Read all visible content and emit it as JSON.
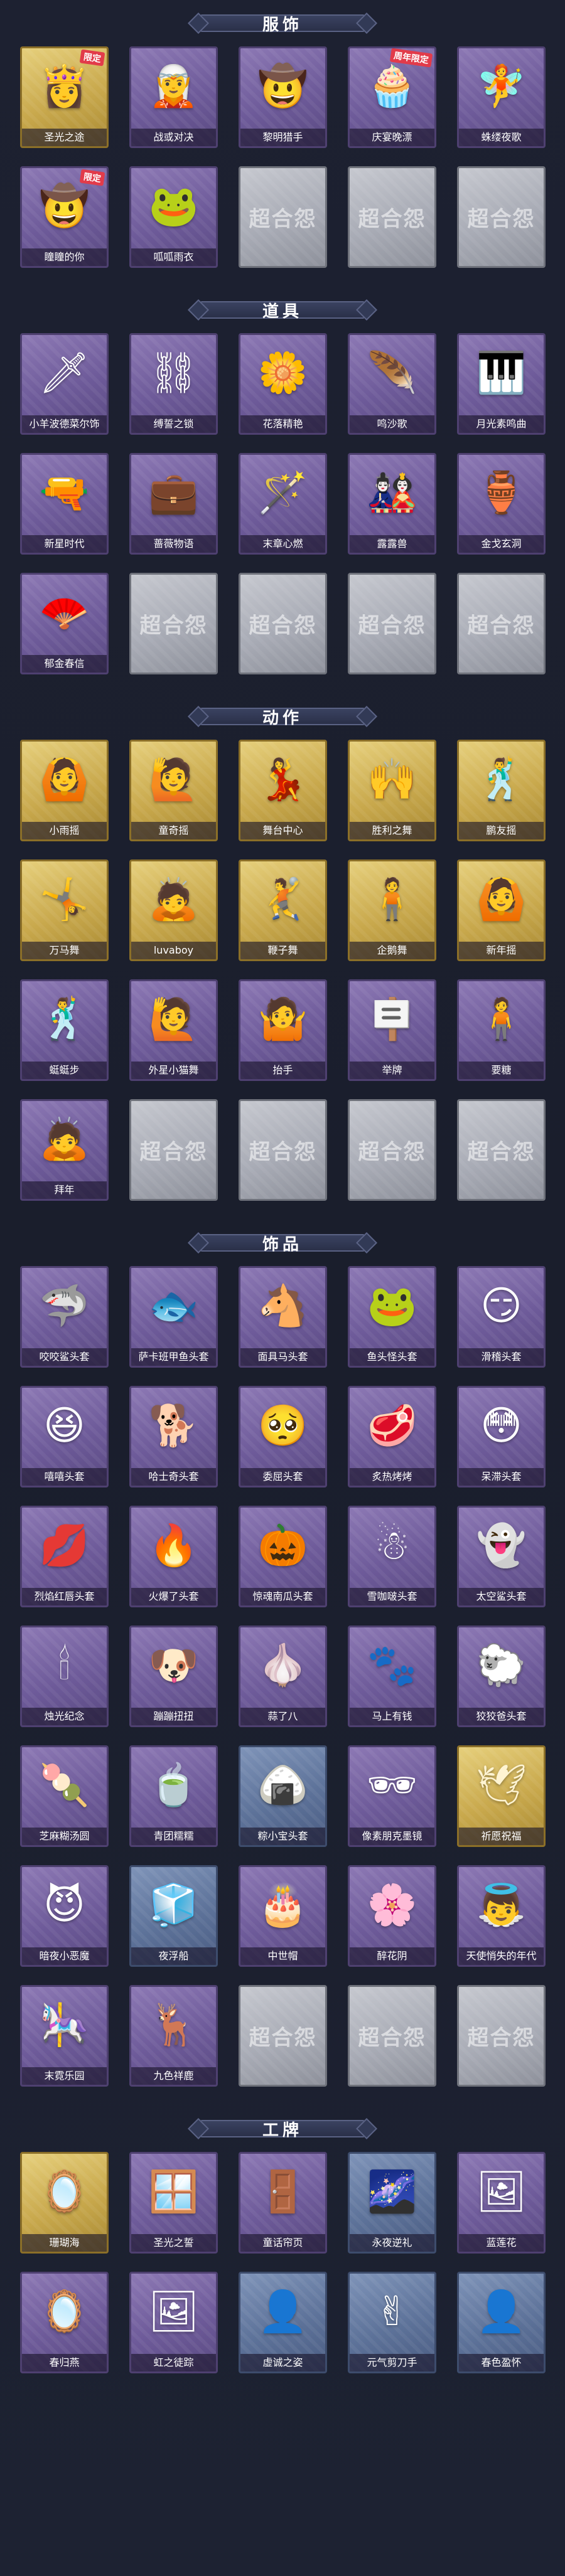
{
  "placeholder": {
    "watermark": "超合怨"
  },
  "sections": [
    {
      "title": "服饰",
      "items": [
        {
          "label": "圣光之途",
          "style": "gold",
          "icon": "👸",
          "badge": "限定"
        },
        {
          "label": "战或对决",
          "style": "purple",
          "icon": "🧝",
          "badge": ""
        },
        {
          "label": "黎明猎手",
          "style": "purple",
          "icon": "🤠",
          "badge": ""
        },
        {
          "label": "庆宴晚漂",
          "style": "purple",
          "icon": "🧁",
          "badge": "周年限定"
        },
        {
          "label": "蛛缕夜歌",
          "style": "purple",
          "icon": "🧚",
          "badge": ""
        },
        {
          "label": "瞳瞳的你",
          "style": "purple",
          "icon": "🤠",
          "badge": "限定"
        },
        {
          "label": "呱呱雨衣",
          "style": "purple",
          "icon": "🐸",
          "badge": ""
        }
      ],
      "empty": 3
    },
    {
      "title": "道具",
      "items": [
        {
          "label": "小羊波德菜尔饰",
          "style": "purple",
          "icon": "🗡",
          "badge": ""
        },
        {
          "label": "缚誓之锁",
          "style": "purple",
          "icon": "⛓",
          "badge": ""
        },
        {
          "label": "花落精艳",
          "style": "purple",
          "icon": "🌼",
          "badge": ""
        },
        {
          "label": "鸣沙歌",
          "style": "purple",
          "icon": "🪶",
          "badge": ""
        },
        {
          "label": "月光素鸣曲",
          "style": "purple",
          "icon": "🎹",
          "badge": ""
        },
        {
          "label": "新星时代",
          "style": "purple",
          "icon": "🔫",
          "badge": ""
        },
        {
          "label": "蔷薇物语",
          "style": "purple",
          "icon": "💼",
          "badge": ""
        },
        {
          "label": "末章心燃",
          "style": "purple",
          "icon": "🪄",
          "badge": ""
        },
        {
          "label": "露露兽",
          "style": "purple",
          "icon": "🎎",
          "badge": ""
        },
        {
          "label": "金戈玄洞",
          "style": "purple",
          "icon": "🏺",
          "badge": ""
        },
        {
          "label": "郁金春信",
          "style": "purple",
          "icon": "🪭",
          "badge": ""
        }
      ],
      "empty": 4
    },
    {
      "title": "动作",
      "items": [
        {
          "label": "小雨摇",
          "style": "gold",
          "icon": "🙆",
          "badge": ""
        },
        {
          "label": "童奇摇",
          "style": "gold",
          "icon": "🙋",
          "badge": ""
        },
        {
          "label": "舞台中心",
          "style": "gold",
          "icon": "💃",
          "badge": ""
        },
        {
          "label": "胜利之舞",
          "style": "gold",
          "icon": "🙌",
          "badge": ""
        },
        {
          "label": "鹏友摇",
          "style": "gold",
          "icon": "🕺",
          "badge": ""
        },
        {
          "label": "万马舞",
          "style": "gold",
          "icon": "🤸",
          "badge": ""
        },
        {
          "label": "luvaboy",
          "style": "gold",
          "icon": "🙇",
          "badge": ""
        },
        {
          "label": "鞭子舞",
          "style": "gold",
          "icon": "🤾",
          "badge": ""
        },
        {
          "label": "企鹅舞",
          "style": "gold",
          "icon": "🧍",
          "badge": ""
        },
        {
          "label": "新年摇",
          "style": "gold",
          "icon": "🙆",
          "badge": ""
        },
        {
          "label": "蜓蜓步",
          "style": "purple",
          "icon": "🕺",
          "badge": ""
        },
        {
          "label": "外星小猫舞",
          "style": "purple",
          "icon": "🙋",
          "badge": ""
        },
        {
          "label": "抬手",
          "style": "purple",
          "icon": "🤷",
          "badge": ""
        },
        {
          "label": "举牌",
          "style": "purple",
          "icon": "🪧",
          "badge": ""
        },
        {
          "label": "要糖",
          "style": "purple",
          "icon": "🧍",
          "badge": ""
        },
        {
          "label": "拜年",
          "style": "purple",
          "icon": "🙇",
          "badge": ""
        }
      ],
      "empty": 4
    },
    {
      "title": "饰品",
      "items": [
        {
          "label": "咬咬鲨头套",
          "style": "purple",
          "icon": "🦈",
          "badge": ""
        },
        {
          "label": "萨卡班甲鱼头套",
          "style": "purple",
          "icon": "🐟",
          "badge": ""
        },
        {
          "label": "面具马头套",
          "style": "purple",
          "icon": "🐴",
          "badge": ""
        },
        {
          "label": "鱼头怪头套",
          "style": "purple",
          "icon": "🐸",
          "badge": ""
        },
        {
          "label": "滑稽头套",
          "style": "purple",
          "icon": "😏",
          "badge": ""
        },
        {
          "label": "嘻嘻头套",
          "style": "purple",
          "icon": "😆",
          "badge": ""
        },
        {
          "label": "哈士奇头套",
          "style": "purple",
          "icon": "🐕",
          "badge": ""
        },
        {
          "label": "委屈头套",
          "style": "purple",
          "icon": "🥺",
          "badge": ""
        },
        {
          "label": "炙热烤烤",
          "style": "purple",
          "icon": "🥩",
          "badge": ""
        },
        {
          "label": "呆滞头套",
          "style": "purple",
          "icon": "😳",
          "badge": ""
        },
        {
          "label": "烈焰红唇头套",
          "style": "purple",
          "icon": "💋",
          "badge": ""
        },
        {
          "label": "火爆了头套",
          "style": "purple",
          "icon": "🔥",
          "badge": ""
        },
        {
          "label": "惊魂南瓜头套",
          "style": "purple",
          "icon": "🎃",
          "badge": ""
        },
        {
          "label": "雪咖啵头套",
          "style": "purple",
          "icon": "☃",
          "badge": ""
        },
        {
          "label": "太空鲨头套",
          "style": "purple",
          "icon": "👻",
          "badge": ""
        },
        {
          "label": "烛光纪念",
          "style": "purple",
          "icon": "🕯",
          "badge": ""
        },
        {
          "label": "蹦蹦扭扭",
          "style": "purple",
          "icon": "🐶",
          "badge": ""
        },
        {
          "label": "蒜了八",
          "style": "purple",
          "icon": "🧄",
          "badge": ""
        },
        {
          "label": "马上有钱",
          "style": "purple",
          "icon": "🐾",
          "badge": ""
        },
        {
          "label": "狡狡爸头套",
          "style": "purple",
          "icon": "🐑",
          "badge": ""
        },
        {
          "label": "芝麻糊汤圆",
          "style": "purple",
          "icon": "🍡",
          "badge": ""
        },
        {
          "label": "青团糯糯",
          "style": "purple",
          "icon": "🍵",
          "badge": ""
        },
        {
          "label": "粽小宝头套",
          "style": "blue",
          "icon": "🍙",
          "badge": ""
        },
        {
          "label": "像素朋克墨镜",
          "style": "purple",
          "icon": "🕶",
          "badge": ""
        },
        {
          "label": "祈愿祝福",
          "style": "gold",
          "icon": "🕊",
          "badge": ""
        },
        {
          "label": "暗夜小恶魔",
          "style": "purple",
          "icon": "😈",
          "badge": ""
        },
        {
          "label": "夜浮船",
          "style": "blue",
          "icon": "🧊",
          "badge": ""
        },
        {
          "label": "中世帽",
          "style": "purple",
          "icon": "🎂",
          "badge": ""
        },
        {
          "label": "醉花阴",
          "style": "purple",
          "icon": "🌸",
          "badge": ""
        },
        {
          "label": "天使悄失的年代",
          "style": "purple",
          "icon": "👼",
          "badge": ""
        },
        {
          "label": "末霓乐园",
          "style": "purple",
          "icon": "🎠",
          "badge": ""
        },
        {
          "label": "九色祥鹿",
          "style": "purple",
          "icon": "🦌",
          "badge": ""
        }
      ],
      "empty": 3
    },
    {
      "title": "工牌",
      "items": [
        {
          "label": "珊瑚海",
          "style": "gold",
          "icon": "🪞",
          "badge": ""
        },
        {
          "label": "圣光之誓",
          "style": "purple",
          "icon": "🪟",
          "badge": ""
        },
        {
          "label": "童话帘页",
          "style": "purple",
          "icon": "🚪",
          "badge": ""
        },
        {
          "label": "永夜逆礼",
          "style": "blue",
          "icon": "🌌",
          "badge": ""
        },
        {
          "label": "蓝莲花",
          "style": "purple",
          "icon": "🖼",
          "badge": ""
        },
        {
          "label": "春归燕",
          "style": "purple",
          "icon": "🪞",
          "badge": ""
        },
        {
          "label": "虹之徒踪",
          "style": "purple",
          "icon": "🖼",
          "badge": ""
        },
        {
          "label": "虚诚之姿",
          "style": "blue",
          "icon": "👤",
          "badge": ""
        },
        {
          "label": "元气剪刀手",
          "style": "blue",
          "icon": "✌",
          "badge": ""
        },
        {
          "label": "春色盈怀",
          "style": "blue",
          "icon": "👤",
          "badge": ""
        }
      ],
      "empty": 0
    }
  ]
}
